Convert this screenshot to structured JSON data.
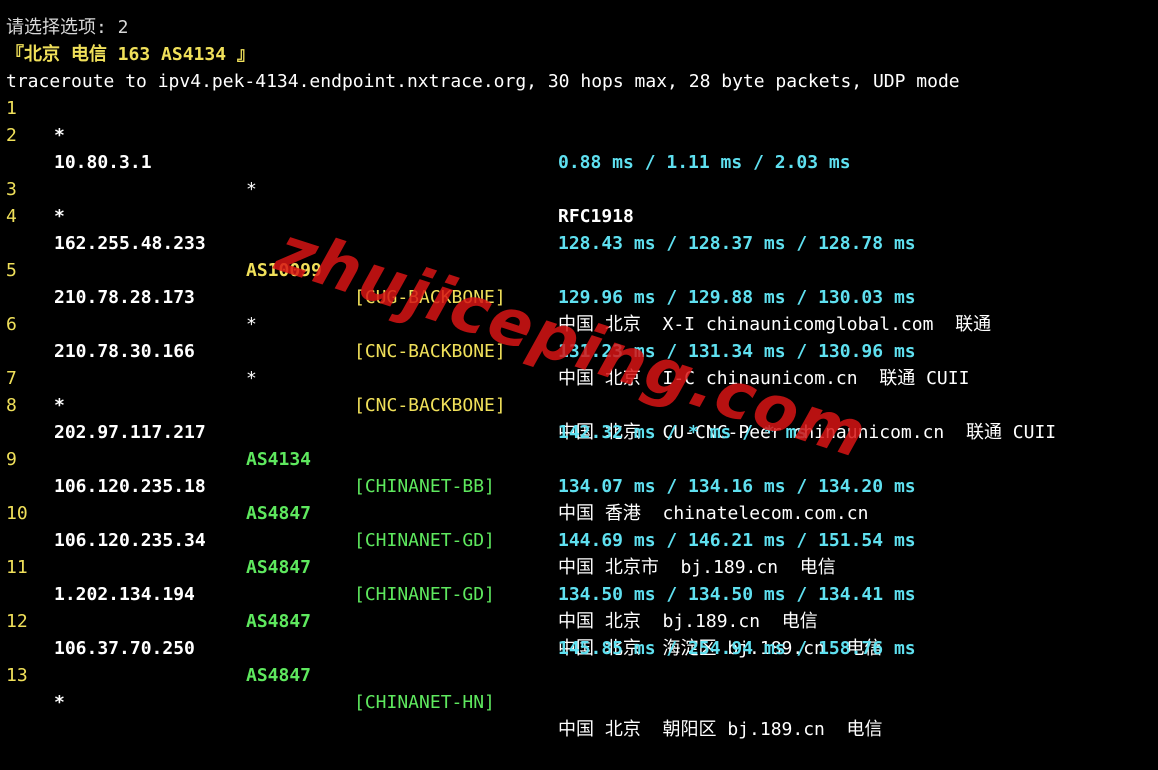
{
  "header": {
    "prev_line": "请选择选项: 2",
    "title": "『北京 电信 163 AS4134 』",
    "command": "traceroute to ipv4.pek-4134.endpoint.nxtrace.org, 30 hops max, 28 byte packets, UDP mode"
  },
  "watermark": "zhujiceping.com",
  "hops": [
    {
      "hop": "1",
      "ip": "*"
    },
    {
      "hop": "2",
      "ip": "10.80.3.1",
      "asn": "*",
      "tag": "",
      "geo": "RFC1918",
      "rtt": "0.88 ms / 1.11 ms / 2.03 ms"
    },
    {
      "hop": "3",
      "ip": "*"
    },
    {
      "hop": "4",
      "ip": "162.255.48.233",
      "asn": "AS10099",
      "tag": "[CUG-BACKBONE]",
      "geo": "中国 北京  X-I chinaunicomglobal.com  联通",
      "rtt": "128.43 ms / 128.37 ms / 128.78 ms"
    },
    {
      "hop": "5",
      "ip": "210.78.28.173",
      "asn": "*",
      "tag": "[CNC-BACKBONE]",
      "geo": "中国 北京  I-C chinaunicom.cn  联通 CUII",
      "rtt": "129.96 ms / 129.88 ms / 130.03 ms"
    },
    {
      "hop": "6",
      "ip": "210.78.30.166",
      "asn": "*",
      "tag": "[CNC-BACKBONE]",
      "geo": "中国 北京  CU-CNC-Peer chinaunicom.cn  联通 CUII",
      "rtt": "131.23 ms / 131.34 ms / 130.96 ms"
    },
    {
      "hop": "7",
      "ip": "*"
    },
    {
      "hop": "8",
      "ip": "202.97.117.217",
      "asn": "AS4134",
      "tag": "[CHINANET-BB]",
      "geo": "中国 香港  chinatelecom.com.cn",
      "rtt": "142.32 ms / * ms / * ms"
    },
    {
      "hop": "9",
      "ip": "106.120.235.18",
      "asn": "AS4847",
      "tag": "[CHINANET-GD]",
      "geo": "中国 北京市  bj.189.cn  电信",
      "rtt": "134.07 ms / 134.16 ms / 134.20 ms"
    },
    {
      "hop": "10",
      "ip": "106.120.235.34",
      "asn": "AS4847",
      "tag": "[CHINANET-GD]",
      "geo": "中国 北京  bj.189.cn  电信",
      "rtt": "144.69 ms / 146.21 ms / 151.54 ms"
    },
    {
      "hop": "11",
      "ip": "1.202.134.194",
      "asn": "AS4847",
      "tag": "",
      "geo": "中国 北京  海淀区 bj.189.cn  电信",
      "rtt": "134.50 ms / 134.50 ms / 134.41 ms"
    },
    {
      "hop": "12",
      "ip": "106.37.70.250",
      "asn": "AS4847",
      "tag": "[CHINANET-HN]",
      "geo": "中国 北京  朝阳区 bj.189.cn  电信",
      "rtt": "145.85 ms / 254.94 ms / 158.76 ms"
    },
    {
      "hop": "13",
      "ip": "*"
    }
  ],
  "colors": {
    "background": "#000000",
    "hop_number": "#f0e05a",
    "asn_yellow": "#f0e05a",
    "asn_green": "#5ee85e",
    "rtt": "#5fe0f0"
  }
}
